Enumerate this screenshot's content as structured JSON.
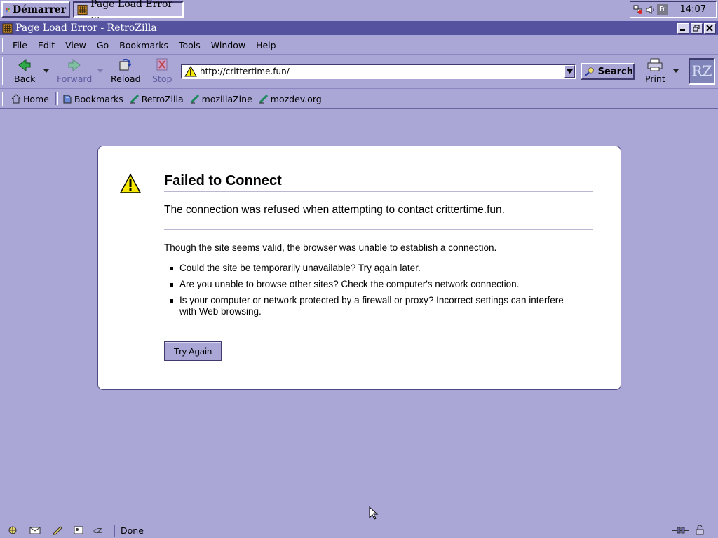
{
  "taskbar": {
    "start_label": "Démarrer",
    "task_label": "Page Load Error ...",
    "lang": "Fr",
    "clock": "14:07"
  },
  "window": {
    "title": "Page Load Error - RetroZilla"
  },
  "menu": {
    "items": [
      "File",
      "Edit",
      "View",
      "Go",
      "Bookmarks",
      "Tools",
      "Window",
      "Help"
    ]
  },
  "toolbar": {
    "back": "Back",
    "forward": "Forward",
    "reload": "Reload",
    "stop": "Stop",
    "search": "Search",
    "print": "Print",
    "logo": "RZ"
  },
  "urlbar": {
    "value": "http://crittertime.fun/"
  },
  "personal_toolbar": {
    "items": [
      "Home",
      "Bookmarks",
      "RetroZilla",
      "mozillaZine",
      "mozdev.org"
    ]
  },
  "error": {
    "title": "Failed to Connect",
    "short_desc": "The connection was refused when attempting to contact crittertime.fun.",
    "long_desc": "Though the site seems valid, the browser was unable to establish a connection.",
    "bullets": [
      "Could the site be temporarily unavailable? Try again later.",
      "Are you unable to browse other sites? Check the computer's network connection.",
      "Is your computer or network protected by a firewall or proxy? Incorrect settings can interfere with Web browsing."
    ],
    "try_again": "Try Again"
  },
  "status": {
    "text": "Done"
  },
  "colors": {
    "desktop": "#a9a5d6",
    "titlebar": "#5553a0",
    "warning_yellow": "#f5e700"
  }
}
